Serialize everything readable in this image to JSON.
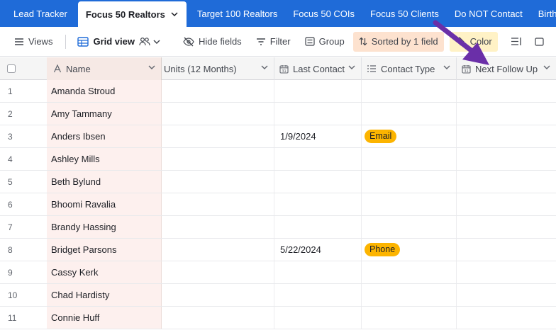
{
  "tabs": [
    {
      "label": "Lead Tracker",
      "active": false
    },
    {
      "label": "Focus 50 Realtors",
      "active": true
    },
    {
      "label": "Target 100 Realtors",
      "active": false
    },
    {
      "label": "Focus 50 COIs",
      "active": false
    },
    {
      "label": "Focus 50 Clients",
      "active": false
    },
    {
      "label": "Do NOT Contact",
      "active": false
    },
    {
      "label": "Birthday",
      "active": false
    }
  ],
  "toolbar": {
    "views": "Views",
    "grid_view": "Grid view",
    "hide_fields": "Hide fields",
    "filter": "Filter",
    "group": "Group",
    "sorted": "Sorted by 1 field",
    "color": "Color"
  },
  "columns": {
    "name": "Name",
    "units": "Units (12 Months)",
    "last_contact": "Last Contact",
    "contact_type": "Contact Type",
    "next_follow_up": "Next Follow Up"
  },
  "rows": [
    {
      "num": "1",
      "name": "Amanda Stroud",
      "last_contact": "",
      "contact_type": ""
    },
    {
      "num": "2",
      "name": "Amy Tammany",
      "last_contact": "",
      "contact_type": ""
    },
    {
      "num": "3",
      "name": "Anders Ibsen",
      "last_contact": "1/9/2024",
      "contact_type": "Email"
    },
    {
      "num": "4",
      "name": "Ashley Mills",
      "last_contact": "",
      "contact_type": ""
    },
    {
      "num": "5",
      "name": "Beth Bylund",
      "last_contact": "",
      "contact_type": ""
    },
    {
      "num": "6",
      "name": "Bhoomi Ravalia",
      "last_contact": "",
      "contact_type": ""
    },
    {
      "num": "7",
      "name": "Brandy Hassing",
      "last_contact": "",
      "contact_type": ""
    },
    {
      "num": "8",
      "name": "Bridget Parsons",
      "last_contact": "5/22/2024",
      "contact_type": "Phone"
    },
    {
      "num": "9",
      "name": "Cassy Kerk",
      "last_contact": "",
      "contact_type": ""
    },
    {
      "num": "10",
      "name": "Chad Hardisty",
      "last_contact": "",
      "contact_type": ""
    },
    {
      "num": "11",
      "name": "Connie Huff",
      "last_contact": "",
      "contact_type": ""
    }
  ],
  "colors": {
    "tab_bar": "#1f6bd8",
    "pill": "#fcb400",
    "sorted_bg": "#fde2cf",
    "color_bg": "#fff2c6",
    "name_col_bg": "#fdf0ee",
    "annotation_arrow": "#6a2fa8"
  },
  "icons": {
    "views": "hamburger-icon",
    "grid": "grid-icon",
    "hide": "eye-slash-icon",
    "filter": "filter-icon",
    "group": "group-icon",
    "sort": "sort-icon",
    "color": "paint-bucket-icon",
    "row_height": "row-height-icon",
    "share": "share-icon"
  }
}
